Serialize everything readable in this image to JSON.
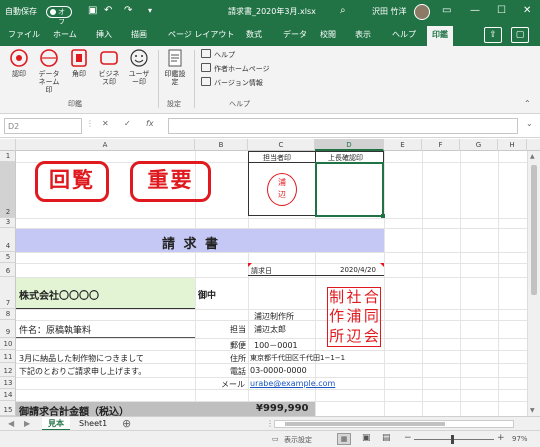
{
  "titlebar": {
    "autosave_label": "自動保存",
    "autosave_state": "オフ",
    "filename": "請求書_2020年3月.xlsx",
    "username": "沢田 竹洋"
  },
  "tabs": [
    "ファイル",
    "ホーム",
    "挿入",
    "描画",
    "ページ レイアウト",
    "数式",
    "データ",
    "校閲",
    "表示",
    "ヘルプ",
    "印鑑"
  ],
  "ribbon": {
    "stamp_buttons": [
      "認印",
      "データネーム印",
      "角印",
      "ビジネス印",
      "ユーザー印"
    ],
    "settings_button": "印鑑設定",
    "help_items": [
      "ヘルプ",
      "作者ホームページ",
      "バージョン情報"
    ],
    "groups": [
      "印鑑",
      "設定",
      "ヘルプ"
    ]
  },
  "formula_bar": {
    "cell_ref": "D2",
    "cancel": "✕",
    "enter": "✓",
    "fx": "fx",
    "value": ""
  },
  "columns": [
    "A",
    "B",
    "C",
    "D",
    "E",
    "F",
    "G",
    "H"
  ],
  "rows": [
    "1",
    "2",
    "3",
    "4",
    "5",
    "6",
    "7",
    "8",
    "9",
    "10",
    "11",
    "12",
    "13",
    "14",
    "15"
  ],
  "sheet": {
    "stamp1": "回覧",
    "stamp2": "重要",
    "approver_header": "担当者印",
    "supervisor_header": "上長確認印",
    "seal_top": "浦",
    "seal_bottom": "辺",
    "invoice_title": "請 求 書",
    "invoice_date_label": "請求日",
    "invoice_date": "2020/4/20",
    "client_name": "株式会社〇〇〇〇",
    "client_suffix": "御中",
    "subject_label": "件名：原稿執筆料",
    "message_line1": "3月に納品した制作物につきまして",
    "message_line2": "下記のとおりご請求申し上げます。",
    "company_name": "浦辺制作所",
    "contact_label": "担当",
    "contact_name": "浦辺太郎",
    "postal_label": "郵便",
    "postal_code": "100－0001",
    "address_label": "住所",
    "address": "東京都千代田区千代田1−1−1",
    "phone_label": "電話",
    "phone": "03-0000-0000",
    "email_label": "メール",
    "email": "urabe@example.com",
    "company_seal": [
      "制",
      "社",
      "合",
      "作",
      "浦",
      "同",
      "所",
      "辺",
      "会"
    ],
    "total_label": "御請求合計金額（税込）",
    "total_amount": "¥999,990"
  },
  "sheet_tabs": [
    "見本",
    "Sheet1"
  ],
  "statusbar": {
    "display_settings": "表示設定",
    "zoom": "97%"
  },
  "colors": {
    "excel_green": "#217346",
    "stamp_red": "#e0191e",
    "title_band": "#c5c8f5",
    "client_fill": "#e2f4d4",
    "link_blue": "#1a56c4"
  }
}
